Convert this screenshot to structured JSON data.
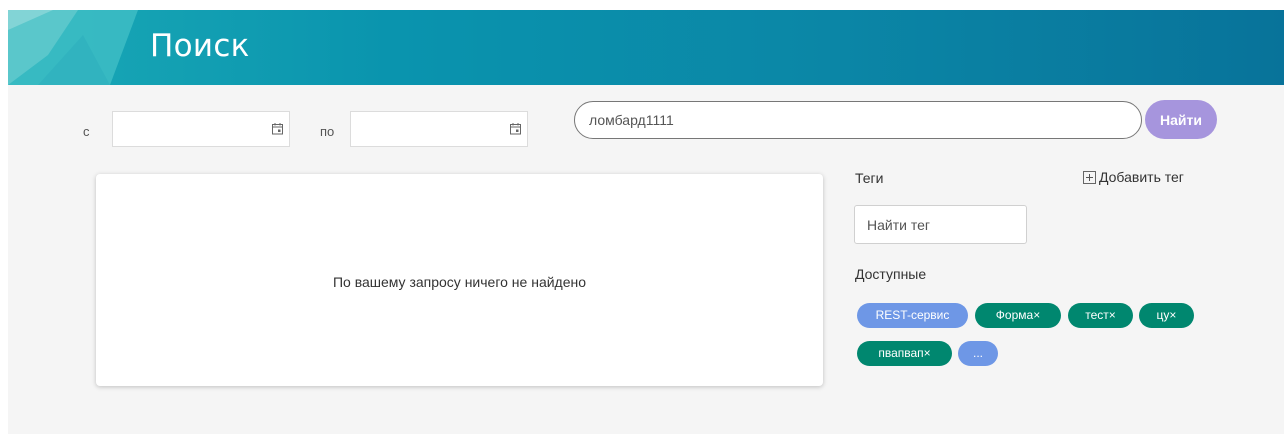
{
  "header": {
    "title": "Поиск"
  },
  "filters": {
    "from_label": "с",
    "to_label": "по",
    "from_value": "",
    "to_value": ""
  },
  "search": {
    "value": "ломбард1111",
    "button_label": "Найти"
  },
  "results": {
    "empty_message": "По вашему запросу ничего не найдено"
  },
  "tags": {
    "title": "Теги",
    "add_label": "Добавить тег",
    "search_placeholder": "Найти тег",
    "available_title": "Доступные",
    "items": [
      {
        "label": "REST-сервис"
      },
      {
        "label": "Форма×"
      },
      {
        "label": "тест×"
      },
      {
        "label": "цу×"
      },
      {
        "label": "пвапвап×"
      },
      {
        "label": "..."
      }
    ]
  },
  "colors": {
    "accent": "#0a8fac",
    "button": "#a695dd",
    "chip_blue": "#6e97e6",
    "chip_green": "#00876f"
  }
}
